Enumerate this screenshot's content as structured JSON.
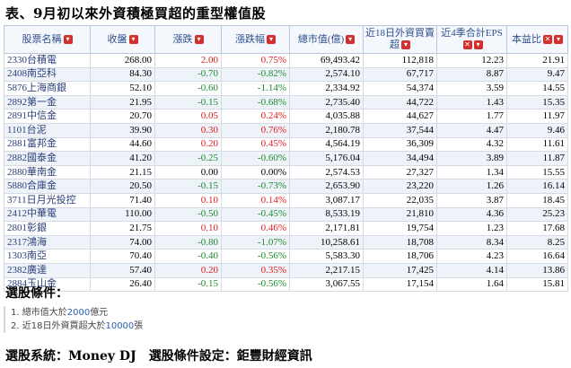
{
  "title": "表、9月初以來外資積極買超的重型權值股",
  "columns": [
    {
      "label": "股票名稱",
      "icons": [
        "sort-icon"
      ]
    },
    {
      "label": "收盤",
      "icons": [
        "sort-icon"
      ]
    },
    {
      "label": "漲跌",
      "icons": [
        "sort-icon"
      ]
    },
    {
      "label": "漲跌幅",
      "icons": [
        "sort-icon"
      ]
    },
    {
      "label": "總市值(億)",
      "icons": [
        "sort-icon"
      ]
    },
    {
      "label": "近18日外資買賣超",
      "icons": [
        "sort-icon"
      ]
    },
    {
      "label": "近4季合計EPS",
      "icons": [
        "remove-icon",
        "sort-icon"
      ]
    },
    {
      "label": "本益比",
      "icons": [
        "remove-icon",
        "sort-icon"
      ]
    }
  ],
  "rows": [
    [
      "2330台積電",
      "268.00",
      "2.00",
      "0.75%",
      "69,493.42",
      "112,818",
      "12.23",
      "21.91",
      "up"
    ],
    [
      "2408南亞科",
      "84.30",
      "-0.70",
      "-0.82%",
      "2,574.10",
      "67,717",
      "8.87",
      "9.47",
      "down"
    ],
    [
      "5876上海商銀",
      "52.10",
      "-0.60",
      "-1.14%",
      "2,334.92",
      "54,374",
      "3.59",
      "14.55",
      "down"
    ],
    [
      "2892第一金",
      "21.95",
      "-0.15",
      "-0.68%",
      "2,735.40",
      "44,722",
      "1.43",
      "15.35",
      "down"
    ],
    [
      "2891中信金",
      "20.70",
      "0.05",
      "0.24%",
      "4,035.88",
      "44,627",
      "1.77",
      "11.97",
      "up"
    ],
    [
      "1101台泥",
      "39.90",
      "0.30",
      "0.76%",
      "2,180.78",
      "37,544",
      "4.47",
      "9.46",
      "up"
    ],
    [
      "2881富邦金",
      "44.60",
      "0.20",
      "0.45%",
      "4,564.19",
      "36,309",
      "4.32",
      "11.61",
      "up"
    ],
    [
      "2882國泰金",
      "41.20",
      "-0.25",
      "-0.60%",
      "5,176.04",
      "34,494",
      "3.89",
      "11.87",
      "down"
    ],
    [
      "2880華南金",
      "21.15",
      "0.00",
      "0.00%",
      "2,574.53",
      "27,327",
      "1.34",
      "15.55",
      "flat"
    ],
    [
      "5880合庫金",
      "20.50",
      "-0.15",
      "-0.73%",
      "2,653.90",
      "23,220",
      "1.26",
      "16.14",
      "down"
    ],
    [
      "3711日月光投控",
      "71.40",
      "0.10",
      "0.14%",
      "3,087.17",
      "22,035",
      "3.87",
      "18.45",
      "up"
    ],
    [
      "2412中華電",
      "110.00",
      "-0.50",
      "-0.45%",
      "8,533.19",
      "21,810",
      "4.36",
      "25.23",
      "down"
    ],
    [
      "2801彰銀",
      "21.75",
      "0.10",
      "0.46%",
      "2,171.81",
      "19,754",
      "1.23",
      "17.68",
      "up"
    ],
    [
      "2317鴻海",
      "74.00",
      "-0.80",
      "-1.07%",
      "10,258.61",
      "18,708",
      "8.34",
      "8.25",
      "down"
    ],
    [
      "1303南亞",
      "70.40",
      "-0.40",
      "-0.56%",
      "5,583.30",
      "18,706",
      "4.23",
      "16.64",
      "down"
    ],
    [
      "2382廣達",
      "57.40",
      "0.20",
      "0.35%",
      "2,217.15",
      "17,425",
      "4.14",
      "13.86",
      "up"
    ],
    [
      "2884玉山金",
      "26.40",
      "-0.15",
      "-0.56%",
      "3,067.55",
      "17,154",
      "1.64",
      "15.81",
      "down"
    ]
  ],
  "criteria_title": "選股條件：",
  "criteria": [
    {
      "num": "1.",
      "pre": "總市值大於",
      "hl": "2000",
      "post": "億元"
    },
    {
      "num": "2.",
      "pre": "近18日外資買超大於",
      "hl": "10000",
      "post": "張"
    }
  ],
  "footer": "選股系統：Money DJ　選股條件設定：鉅豐財經資訊",
  "colors": {
    "up": "#e01b1b",
    "down": "#1c8a2b",
    "header_text": "#2f4f8f",
    "icon_bg": "#d32f2f"
  }
}
